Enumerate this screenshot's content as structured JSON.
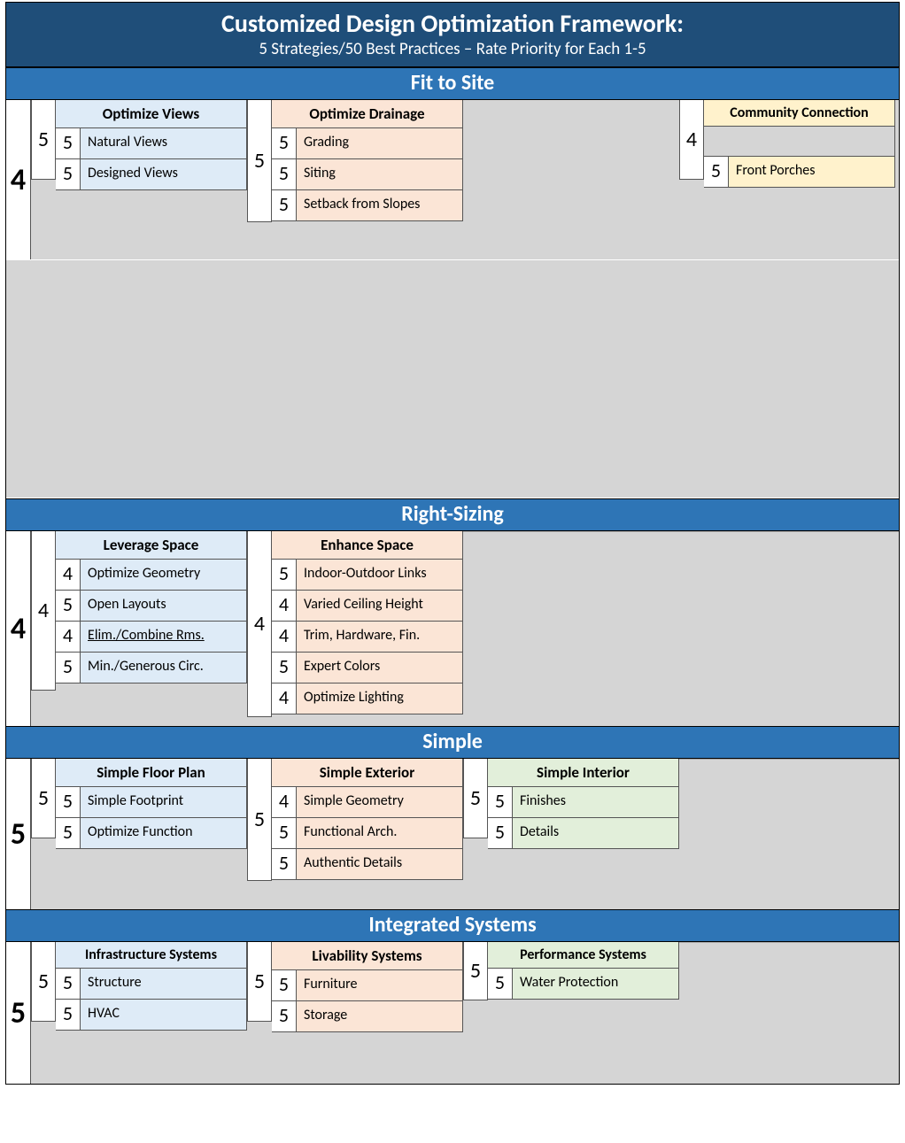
{
  "header": {
    "title": "Customized Design Optimization Framework:",
    "subtitle": "5 Strategies/50 Best Practices – Rate Priority for Each 1-5"
  },
  "strategies": [
    {
      "name": "Fit to Site",
      "overall": "4",
      "groups": [
        {
          "title": "Optimize Views",
          "colorHint": "blue",
          "score": "5",
          "items": [
            {
              "score": "5",
              "label": "Natural Views"
            },
            {
              "score": "5",
              "label": "Designed Views"
            }
          ]
        },
        {
          "title": "Optimize Drainage",
          "colorHint": "peach",
          "score": "5",
          "items": [
            {
              "score": "5",
              "label": "Grading"
            },
            {
              "score": "5",
              "label": "Siting"
            },
            {
              "score": "5",
              "label": "Setback from Slopes"
            }
          ]
        },
        null,
        {
          "title": "Community Connection",
          "colorHint": "yellow",
          "score": "4",
          "items": [
            {
              "score": "5",
              "label": "Front Porches"
            }
          ]
        }
      ]
    },
    {
      "name": "Right-Sizing",
      "overall": "4",
      "groups": [
        {
          "title": "Leverage Space",
          "colorHint": "blue",
          "score": "4",
          "items": [
            {
              "score": "4",
              "label": "Optimize Geometry"
            },
            {
              "score": "5",
              "label": "Open Layouts"
            },
            {
              "score": "4",
              "label": "Elim./Combine Rms."
            },
            {
              "score": "5",
              "label": "Min./Generous Circ."
            }
          ]
        },
        {
          "title": "Enhance Space",
          "colorHint": "peach",
          "score": "4",
          "items": [
            {
              "score": "5",
              "label": "Indoor-Outdoor Links"
            },
            {
              "score": "4",
              "label": "Varied Ceiling Height"
            },
            {
              "score": "4",
              "label": "Trim, Hardware, Fin."
            },
            {
              "score": "5",
              "label": "Expert Colors"
            },
            {
              "score": "4",
              "label": "Optimize Lighting"
            }
          ]
        }
      ]
    },
    {
      "name": "Simple",
      "overall": "5",
      "groups": [
        {
          "title": "Simple Floor Plan",
          "colorHint": "blue",
          "score": "5",
          "items": [
            {
              "score": "5",
              "label": "Simple Footprint"
            },
            {
              "score": "5",
              "label": "Optimize Function"
            }
          ]
        },
        {
          "title": "Simple Exterior",
          "colorHint": "peach",
          "score": "5",
          "items": [
            {
              "score": "4",
              "label": "Simple Geometry"
            },
            {
              "score": "5",
              "label": "Functional Arch."
            },
            {
              "score": "5",
              "label": "Authentic Details"
            }
          ]
        },
        {
          "title": "Simple Interior",
          "colorHint": "green",
          "score": "5",
          "items": [
            {
              "score": "5",
              "label": "Finishes"
            },
            {
              "score": "5",
              "label": "Details"
            }
          ]
        }
      ]
    },
    {
      "name": "Integrated Systems",
      "overall": "5",
      "groups": [
        {
          "title": "Infrastructure Systems",
          "colorHint": "blue",
          "score": "5",
          "items": [
            {
              "score": "5",
              "label": "Structure"
            },
            {
              "score": "5",
              "label": "HVAC"
            }
          ]
        },
        {
          "title": "Livability Systems",
          "colorHint": "peach",
          "score": "5",
          "items": [
            {
              "score": "5",
              "label": "Furniture"
            },
            {
              "score": "5",
              "label": "Storage"
            }
          ]
        },
        {
          "title": "Performance Systems",
          "colorHint": "green",
          "score": "5",
          "items": [
            {
              "score": "5",
              "label": "Water Protection"
            }
          ]
        }
      ]
    }
  ]
}
